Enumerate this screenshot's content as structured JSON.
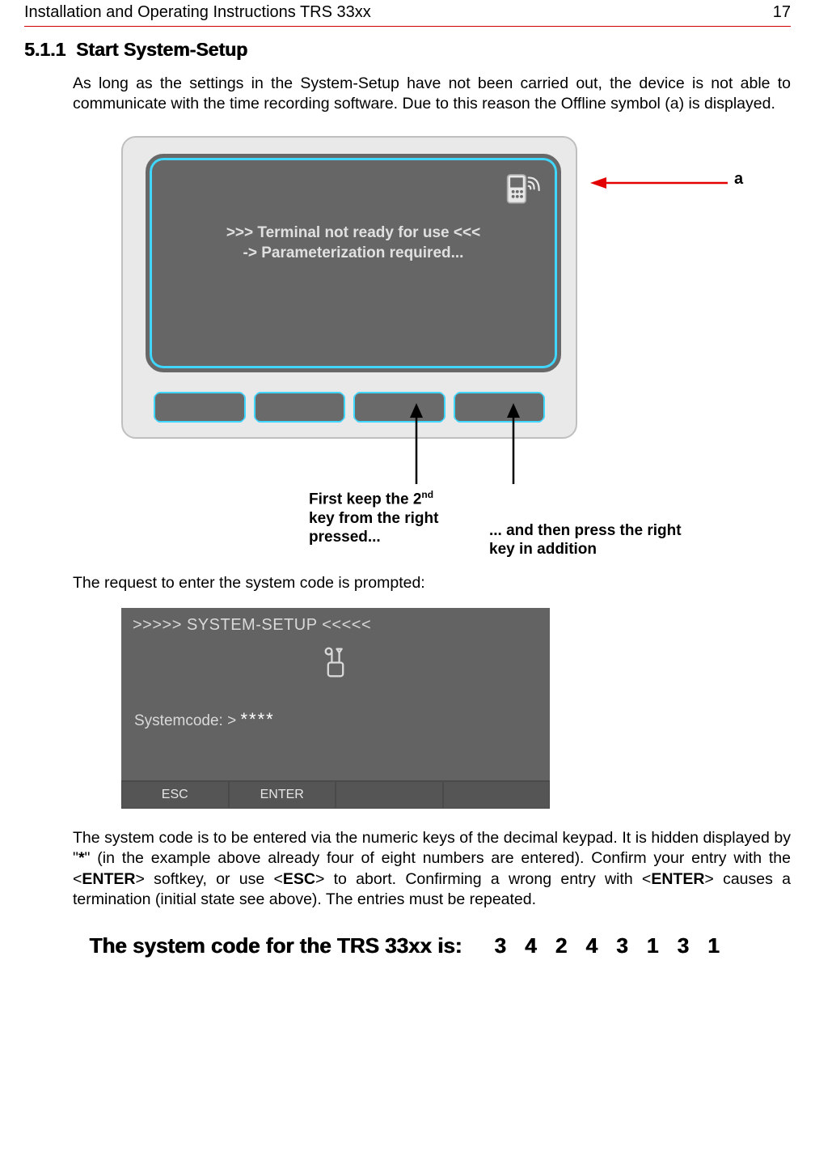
{
  "header": {
    "title": "Installation and Operating Instructions TRS 33xx",
    "page_number": "17"
  },
  "section": {
    "number": "5.1.1",
    "title": "Start System-Setup"
  },
  "paragraphs": {
    "intro": "As long as the settings in the System-Setup have not been carried out, the device is not able to communicate with the time recording software. Due to this reason the Offline symbol (a) is displayed.",
    "prompt_intro": "The request to enter the system code is prompted:",
    "entry_text_pre": "The system code is to be entered via the numeric keys of the decimal keypad. It is hidden displayed by \"",
    "entry_text_star": "*",
    "entry_text_post": "\"  (in the example above already four of eight numbers are entered). Confirm your entry with the <",
    "enter1": "ENTER",
    "entry_text_post2": "> softkey, or use <",
    "esc": "ESC",
    "entry_text_post3": "> to abort. Confirming a wrong entry with <",
    "enter2": "ENTER",
    "entry_text_post4": "> causes a termination (initial state see above). The entries must be repeated."
  },
  "device_screen": {
    "line1": ">>> Terminal not ready for use <<<",
    "line2": "-> Parameterization required..."
  },
  "callouts": {
    "a_label": "a",
    "instr_left_line1": "First keep the 2",
    "instr_left_sup": "nd",
    "instr_left_line2": "key from the right pressed...",
    "instr_right": "... and then press the right key in addition"
  },
  "setup_screen": {
    "title": ">>>>> SYSTEM-SETUP <<<<<",
    "systemcode_label": "Systemcode: >",
    "systemcode_value": "****",
    "softkeys": [
      "ESC",
      "ENTER",
      "",
      ""
    ]
  },
  "final": {
    "label": "The system code for the TRS 33xx is:",
    "code": "3 4 2 4 3 1 3 1"
  }
}
